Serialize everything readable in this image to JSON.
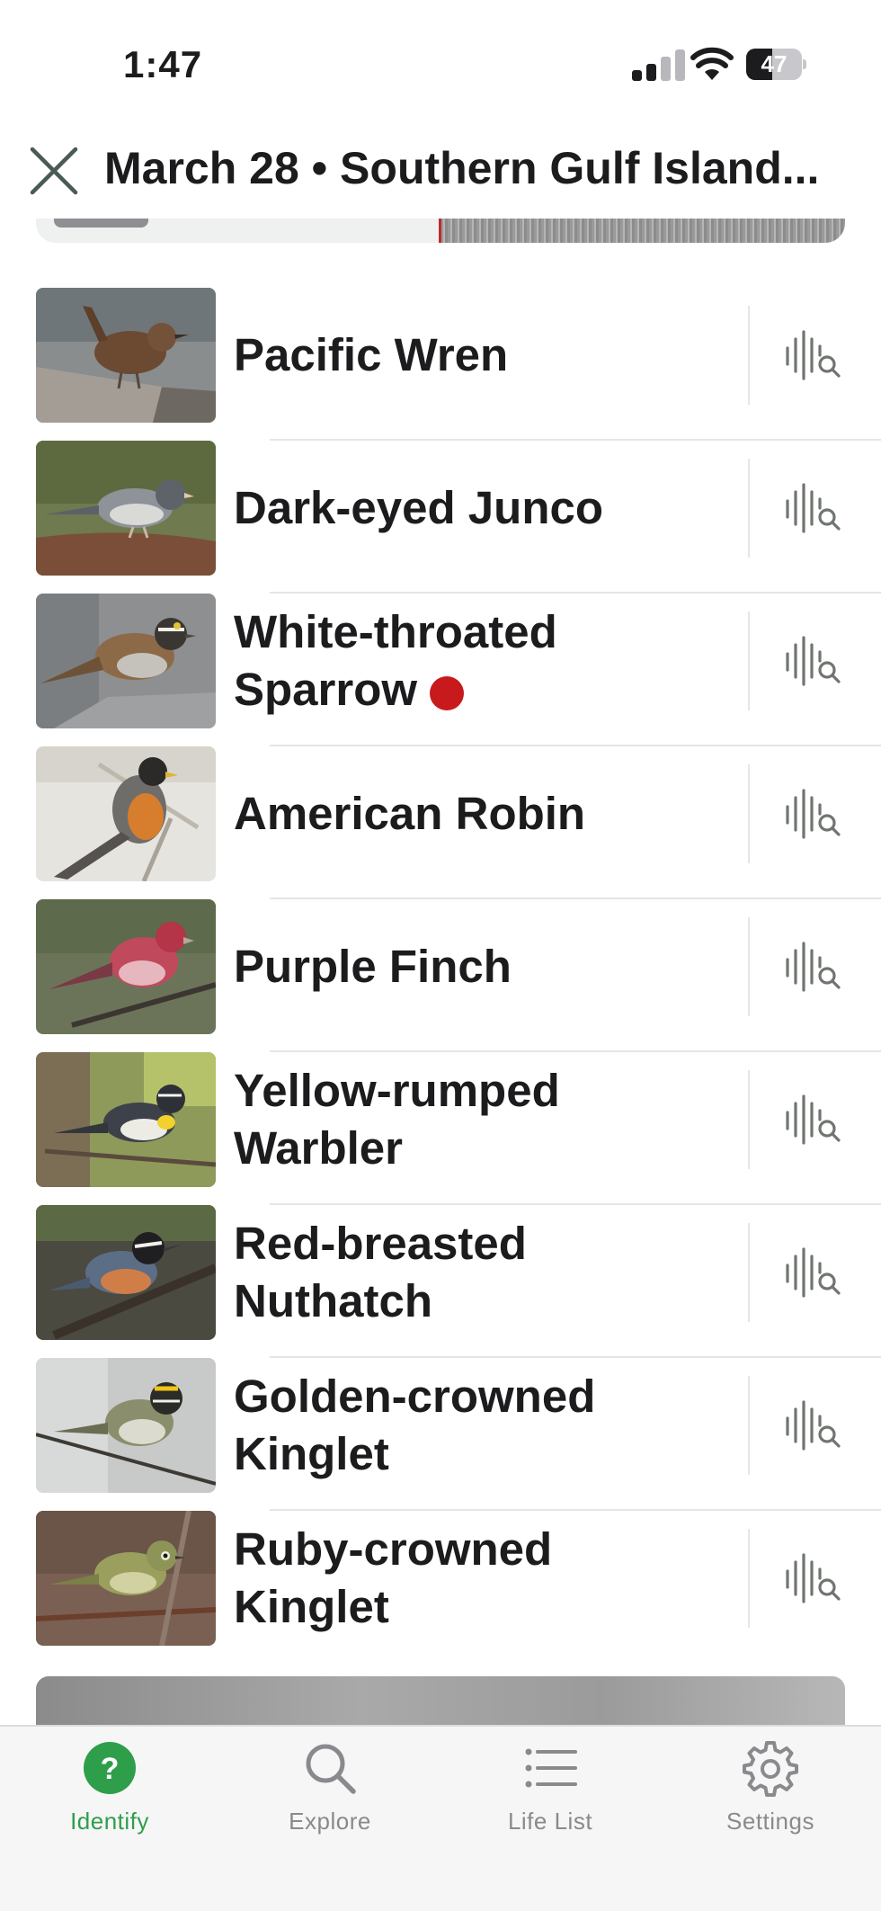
{
  "status_bar": {
    "time": "1:47",
    "battery": "47",
    "icons": [
      "cellular-signal-icon",
      "wifi-icon",
      "battery-icon"
    ]
  },
  "header": {
    "title": "March 28 • Southern Gulf Island...",
    "close_icon": "close-icon"
  },
  "colors": {
    "accent_green": "#2e9e4b",
    "new_species_red": "#c8191c",
    "playhead_red": "#c0292b"
  },
  "species": [
    {
      "name": "Pacific Wren",
      "new": false
    },
    {
      "name": "Dark-eyed Junco",
      "new": false
    },
    {
      "name": "White-throated Sparrow",
      "new": true
    },
    {
      "name": "American Robin",
      "new": false
    },
    {
      "name": "Purple Finch",
      "new": false
    },
    {
      "name": "Yellow-rumped Warbler",
      "new": false
    },
    {
      "name": "Red-breasted Nuthatch",
      "new": false
    },
    {
      "name": "Golden-crowned Kinglet",
      "new": false
    },
    {
      "name": "Ruby-crowned Kinglet",
      "new": false
    }
  ],
  "tabs": [
    {
      "label": "Identify",
      "icon": "question-icon",
      "active": true
    },
    {
      "label": "Explore",
      "icon": "search-icon",
      "active": false
    },
    {
      "label": "Life List",
      "icon": "list-icon",
      "active": false
    },
    {
      "label": "Settings",
      "icon": "gear-icon",
      "active": false
    }
  ]
}
